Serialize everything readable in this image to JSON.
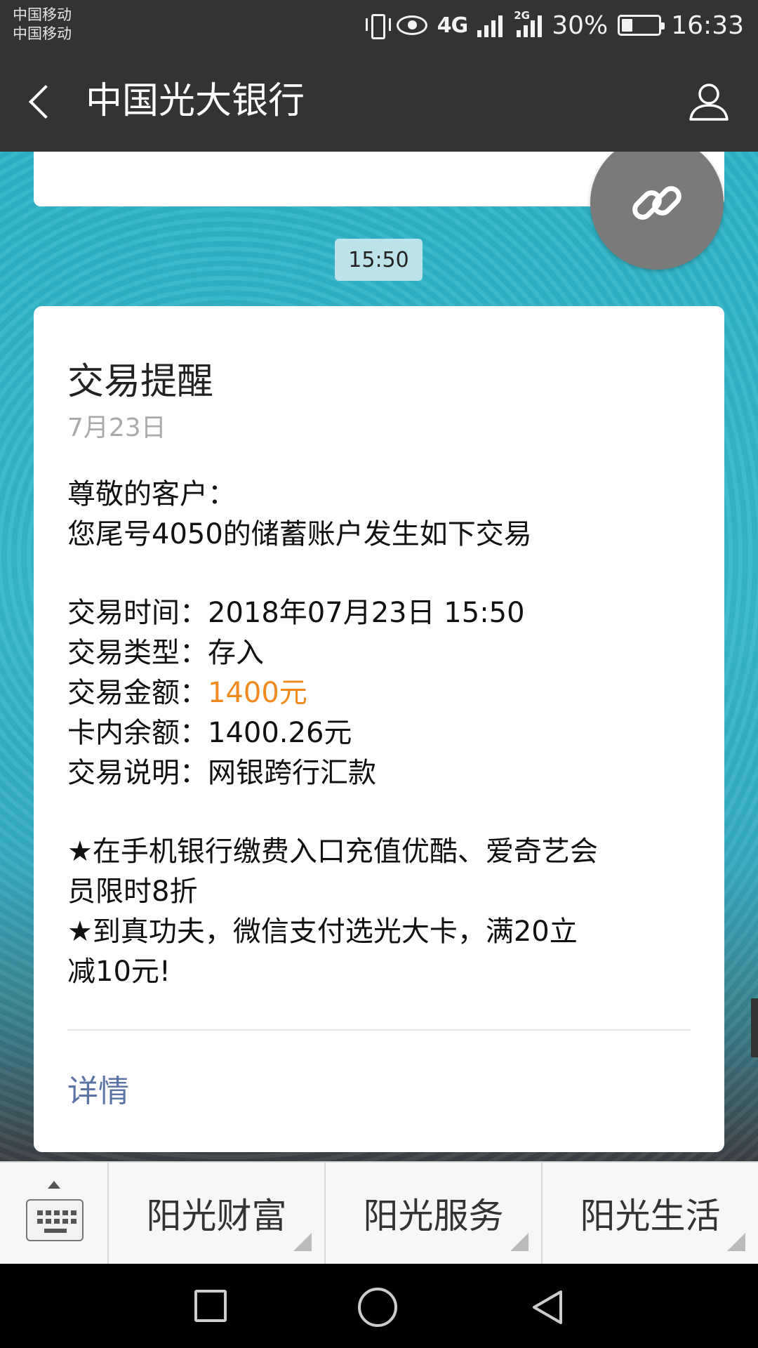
{
  "status_bar": {
    "carrier_1": "中国移动",
    "carrier_2": "中国移动",
    "network_1": "4G",
    "network_2": "2G",
    "battery_percent": "30%",
    "battery_level": 0.3,
    "time": "16:33"
  },
  "header": {
    "title": "中国光大银行"
  },
  "chat": {
    "timestamp": "15:50",
    "card": {
      "title": "交易提醒",
      "date": "7月23日",
      "greeting": "尊敬的客户：",
      "intro": "您尾号4050的储蓄账户发生如下交易",
      "fields": [
        {
          "label": "交易时间：",
          "value": "2018年07月23日  15:50"
        },
        {
          "label": "交易类型：",
          "value": "存入"
        },
        {
          "label": "交易金额：",
          "value": "1400元"
        },
        {
          "label": "卡内余额：",
          "value": "1400.26元"
        },
        {
          "label": "交易说明：",
          "value": "网银跨行汇款"
        }
      ],
      "promo_1_line_1": "★在手机银行缴费入口充值优酷、爱奇艺会",
      "promo_1_line_2": "员限时8折",
      "promo_2_line_1": "★到真功夫，微信支付选光大卡，满20立",
      "promo_2_line_2": "减10元!",
      "detail_link": "详情"
    }
  },
  "menu": {
    "items": [
      "阳光财富",
      "阳光服务",
      "阳光生活"
    ]
  },
  "colors": {
    "header_bg": "#333333",
    "amount_highlight": "#f08a1e",
    "link": "#5b74a6",
    "chat_bg": "#35b2c5"
  }
}
